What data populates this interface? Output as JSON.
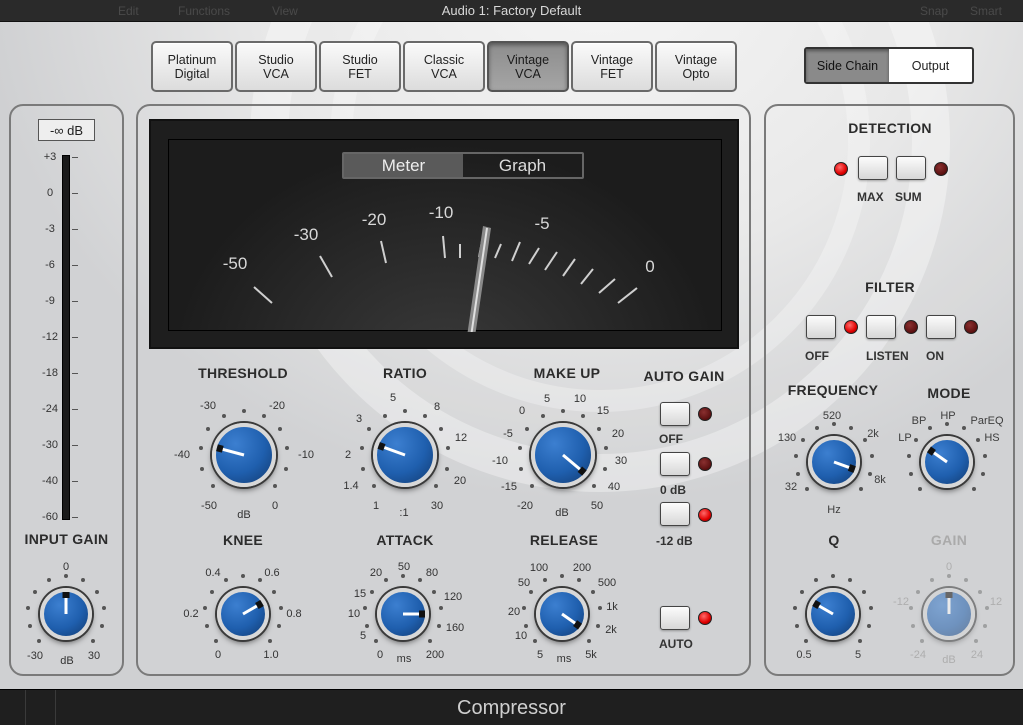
{
  "window": {
    "title": "Audio 1: Factory Default",
    "menu_edit": "Edit",
    "menu_functions": "Functions",
    "menu_view": "View",
    "menu_snap": "Snap",
    "menu_smart": "Smart"
  },
  "models": [
    {
      "label": "Platinum\nDigital",
      "active": false
    },
    {
      "label": "Studio\nVCA",
      "active": false
    },
    {
      "label": "Studio\nFET",
      "active": false
    },
    {
      "label": "Classic\nVCA",
      "active": false
    },
    {
      "label": "Vintage\nVCA",
      "active": true
    },
    {
      "label": "Vintage\nFET",
      "active": false
    },
    {
      "label": "Vintage\nOpto",
      "active": false
    }
  ],
  "sidechain_toggle": {
    "side_chain": "Side Chain",
    "output": "Output",
    "selected": "Side Chain"
  },
  "input_gain": {
    "readout": "-∞ dB",
    "scale": [
      "+3",
      "0",
      "-3",
      "-6",
      "-9",
      "-12",
      "-18",
      "-24",
      "-30",
      "-40",
      "-60"
    ],
    "label": "INPUT GAIN",
    "knob_min": "-30",
    "knob_max": "30",
    "knob_center": "0",
    "unit": "dB"
  },
  "meter": {
    "tabs": {
      "meter": "Meter",
      "graph": "Graph",
      "selected": "Meter"
    },
    "scale": [
      "-50",
      "-30",
      "-20",
      "-10",
      "-5",
      "0"
    ]
  },
  "controls": {
    "threshold": {
      "label": "THRESHOLD",
      "ticks": [
        "-30",
        "-20",
        "-40",
        "-10",
        "-50",
        "0"
      ],
      "unit": "dB"
    },
    "ratio": {
      "label": "RATIO",
      "ticks": [
        "5",
        "3",
        "8",
        "12",
        "2",
        "1.4",
        "20",
        "1",
        "30"
      ],
      "unit": ":1"
    },
    "makeup": {
      "label": "MAKE UP",
      "ticks": [
        "0",
        "5",
        "10",
        "15",
        "-5",
        "20",
        "-10",
        "30",
        "-15",
        "40",
        "-20",
        "50"
      ],
      "unit": "dB"
    },
    "knee": {
      "label": "KNEE",
      "ticks": [
        "0.4",
        "0.6",
        "0.2",
        "0.8",
        "0",
        "1.0"
      ]
    },
    "attack": {
      "label": "ATTACK",
      "ticks": [
        "20",
        "50",
        "80",
        "15",
        "120",
        "10",
        "160",
        "5",
        "0",
        "200"
      ],
      "unit": "ms"
    },
    "release": {
      "label": "RELEASE",
      "ticks": [
        "100",
        "200",
        "50",
        "500",
        "20",
        "1k",
        "10",
        "2k",
        "5",
        "5k"
      ],
      "unit": "ms"
    }
  },
  "auto_gain": {
    "label": "AUTO GAIN",
    "off": "OFF",
    "zero_db": "0 dB",
    "minus12": "-12 dB",
    "auto": "AUTO"
  },
  "detection": {
    "label": "DETECTION",
    "max": "MAX",
    "sum": "SUM"
  },
  "filter": {
    "label": "FILTER",
    "off": "OFF",
    "listen": "LISTEN",
    "on": "ON",
    "frequency": {
      "label": "FREQUENCY",
      "ticks": [
        "520",
        "130",
        "2k",
        "32",
        "8k"
      ],
      "unit": "Hz"
    },
    "mode": {
      "label": "MODE",
      "ticks": [
        "BP",
        "HP",
        "ParEQ",
        "LP",
        "HS"
      ]
    },
    "q": {
      "label": "Q",
      "min": "0.5",
      "max": "5"
    },
    "gain": {
      "label": "GAIN",
      "center": "0",
      "left": "-12",
      "right": "12",
      "min": "-24",
      "max": "24",
      "unit": "dB"
    }
  },
  "plugin_name": "Compressor"
}
